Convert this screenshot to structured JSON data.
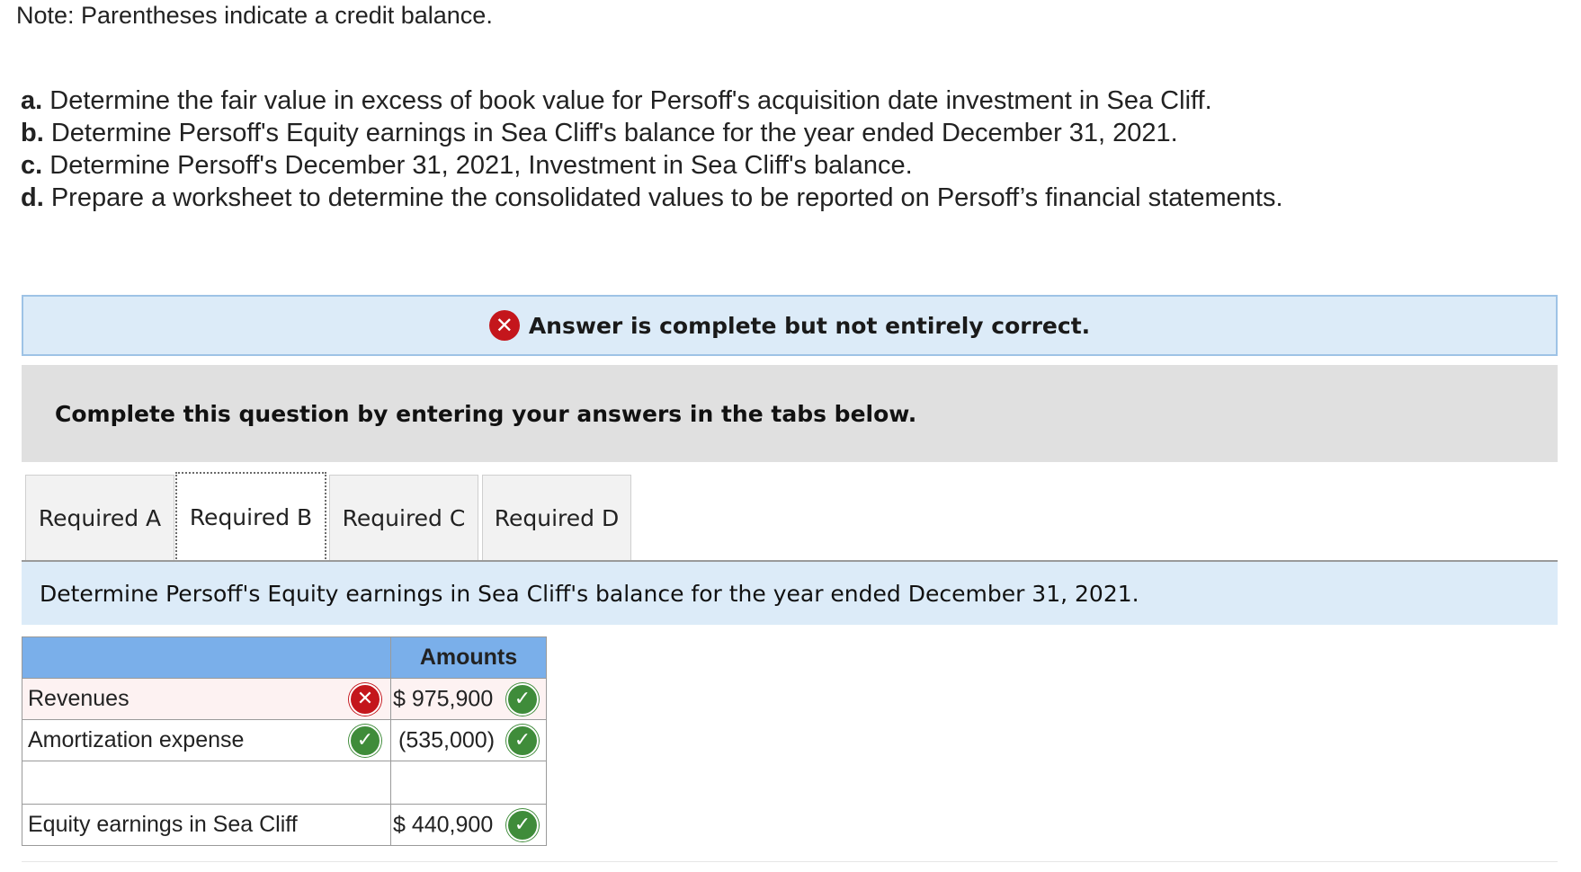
{
  "note": "Note: Parentheses indicate a credit balance.",
  "requirements": [
    {
      "letter": "a.",
      "text": "Determine the fair value in excess of book value for Persoff's acquisition date investment in Sea Cliff."
    },
    {
      "letter": "b.",
      "text": "Determine Persoff's Equity earnings in Sea Cliff's balance for the year ended December 31, 2021."
    },
    {
      "letter": "c.",
      "text": "Determine Persoff's December 31, 2021, Investment in Sea Cliff's balance."
    },
    {
      "letter": "d.",
      "text": "Prepare a worksheet to determine the consolidated values to be reported on Persoff’s financial statements."
    }
  ],
  "banner": {
    "icon": "x-circle-icon",
    "text": "Answer is complete but not entirely correct."
  },
  "complete_text": "Complete this question by entering your answers in the tabs below.",
  "tabs": [
    {
      "label": "Required A",
      "active": false
    },
    {
      "label": "Required B",
      "active": true
    },
    {
      "label": "Required C",
      "active": false
    },
    {
      "label": "Required D",
      "active": false
    }
  ],
  "instruction": "Determine Persoff's Equity earnings in Sea Cliff's balance for the year ended December 31, 2021.",
  "table": {
    "header_amounts": "Amounts",
    "rows": [
      {
        "label": "Revenues",
        "label_status": "incorrect",
        "value": "$ 975,900",
        "value_status": "correct"
      },
      {
        "label": "Amortization expense",
        "label_status": "correct",
        "value": "(535,000)",
        "value_status": "correct"
      },
      {
        "label": "",
        "value": ""
      },
      {
        "label": "Equity earnings in Sea Cliff",
        "value": "$ 440,900",
        "value_status": "correct"
      }
    ]
  },
  "colors": {
    "correct": "#3f8c3a",
    "incorrect": "#c4161c",
    "header": "#7aafea",
    "banner": "#dcebf8"
  }
}
